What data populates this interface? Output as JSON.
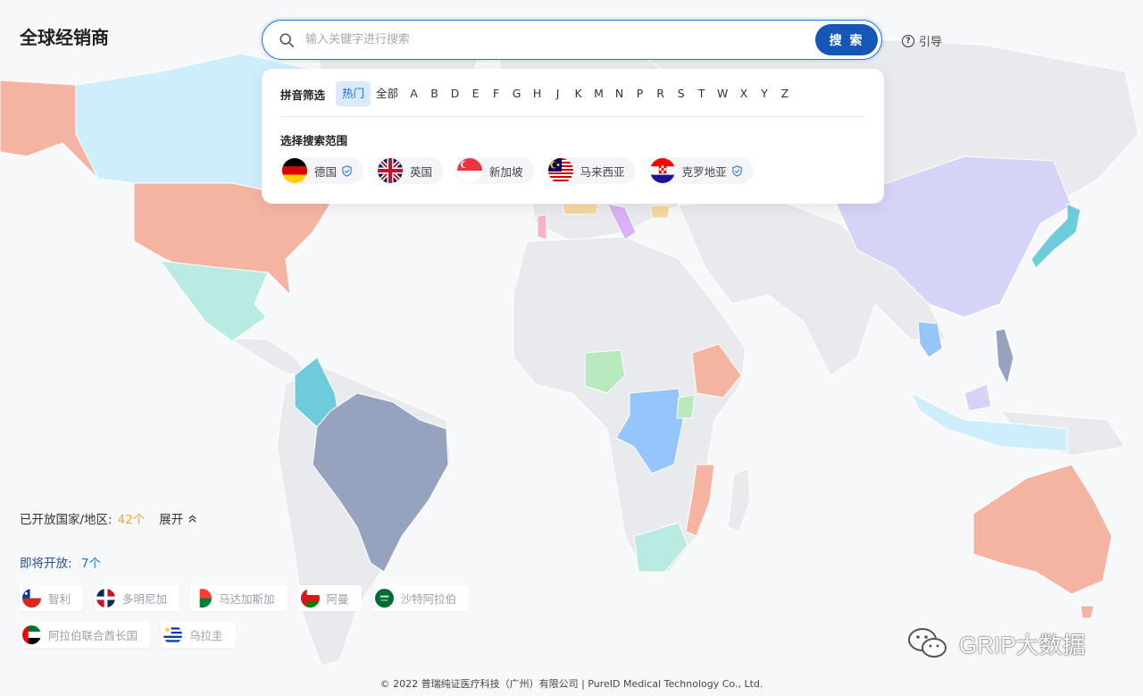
{
  "page": {
    "title": "全球经销商"
  },
  "search": {
    "placeholder": "输入关键字进行搜索",
    "button_label": "搜 索"
  },
  "guide": {
    "label": "引导"
  },
  "pinyin_filter": {
    "label": "拼音筛选",
    "active": "热门",
    "items": [
      "热门",
      "全部",
      "A",
      "B",
      "D",
      "E",
      "F",
      "G",
      "H",
      "J",
      "K",
      "M",
      "N",
      "P",
      "R",
      "S",
      "T",
      "W",
      "X",
      "Y",
      "Z"
    ]
  },
  "search_scope": {
    "label": "选择搜索范围",
    "countries": [
      {
        "name": "德国",
        "verified": true,
        "flag": "germany"
      },
      {
        "name": "英国",
        "verified": false,
        "flag": "uk"
      },
      {
        "name": "新加坡",
        "verified": false,
        "flag": "singapore"
      },
      {
        "name": "马来西亚",
        "verified": false,
        "flag": "malaysia"
      },
      {
        "name": "克罗地亚",
        "verified": true,
        "flag": "croatia"
      }
    ]
  },
  "open_stats": {
    "label": "已开放国家/地区:",
    "count": "42个",
    "expand_label": "展开"
  },
  "coming_soon": {
    "label": "即将开放:",
    "count": "7个",
    "countries": [
      {
        "name": "智利",
        "flag": "chile"
      },
      {
        "name": "多明尼加",
        "flag": "dominican"
      },
      {
        "name": "马达加斯加",
        "flag": "madagascar"
      },
      {
        "name": "阿曼",
        "flag": "oman"
      },
      {
        "name": "沙特阿拉伯",
        "flag": "saudi"
      },
      {
        "name": "阿拉伯联合酋长国",
        "flag": "uae"
      },
      {
        "name": "乌拉圭",
        "flag": "uruguay"
      }
    ]
  },
  "footer": {
    "text": "© 2022 普瑞纯证医疗科技（广州）有限公司 | PureID Medical Technology Co., Ltd."
  },
  "watermark": {
    "text": "GRIP大数据"
  },
  "colors": {
    "land": "#e8eaed",
    "accent": "#1556b8",
    "open_count": "#f5a623",
    "soon_count": "#1a73e8"
  }
}
